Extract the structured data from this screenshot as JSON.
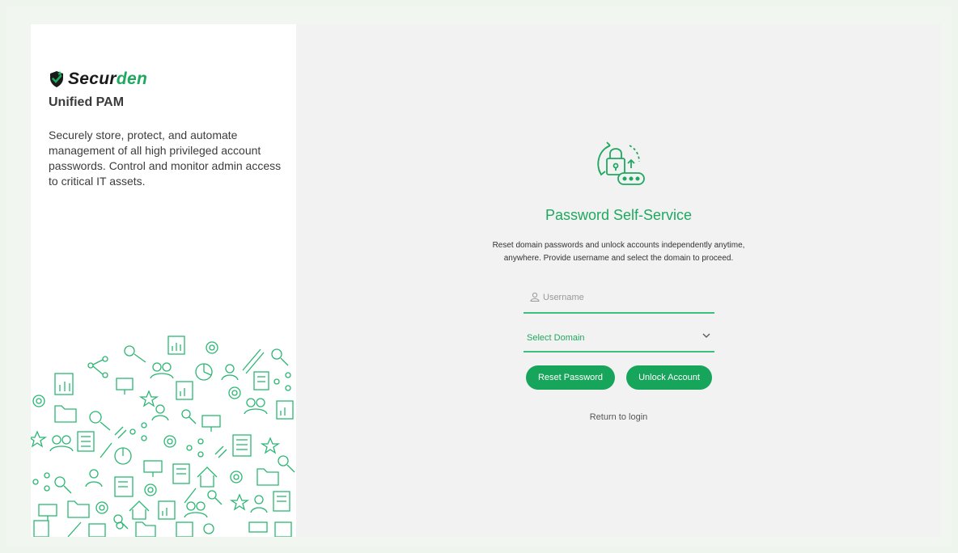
{
  "brand": {
    "logo_prefix": "Secur",
    "logo_accent": "den",
    "product_name": "Unified PAM",
    "tagline": "Securely store, protect, and automate management of all high privileged account passwords. Control and monitor admin access to critical IT assets.",
    "accent_color": "#1fa85f"
  },
  "form": {
    "title": "Password Self-Service",
    "description_line1": "Reset domain passwords and unlock accounts independently anytime,",
    "description_line2": "anywhere. Provide username and select the domain to proceed.",
    "username_placeholder": "Username",
    "domain_label": "Select Domain",
    "reset_button": "Reset Password",
    "unlock_button": "Unlock Account",
    "return_link": "Return to login"
  },
  "icons": {
    "logo": "shield-check-icon",
    "hero": "padlock-refresh-password-icon",
    "user": "user-icon",
    "chevron": "chevron-down-icon"
  }
}
